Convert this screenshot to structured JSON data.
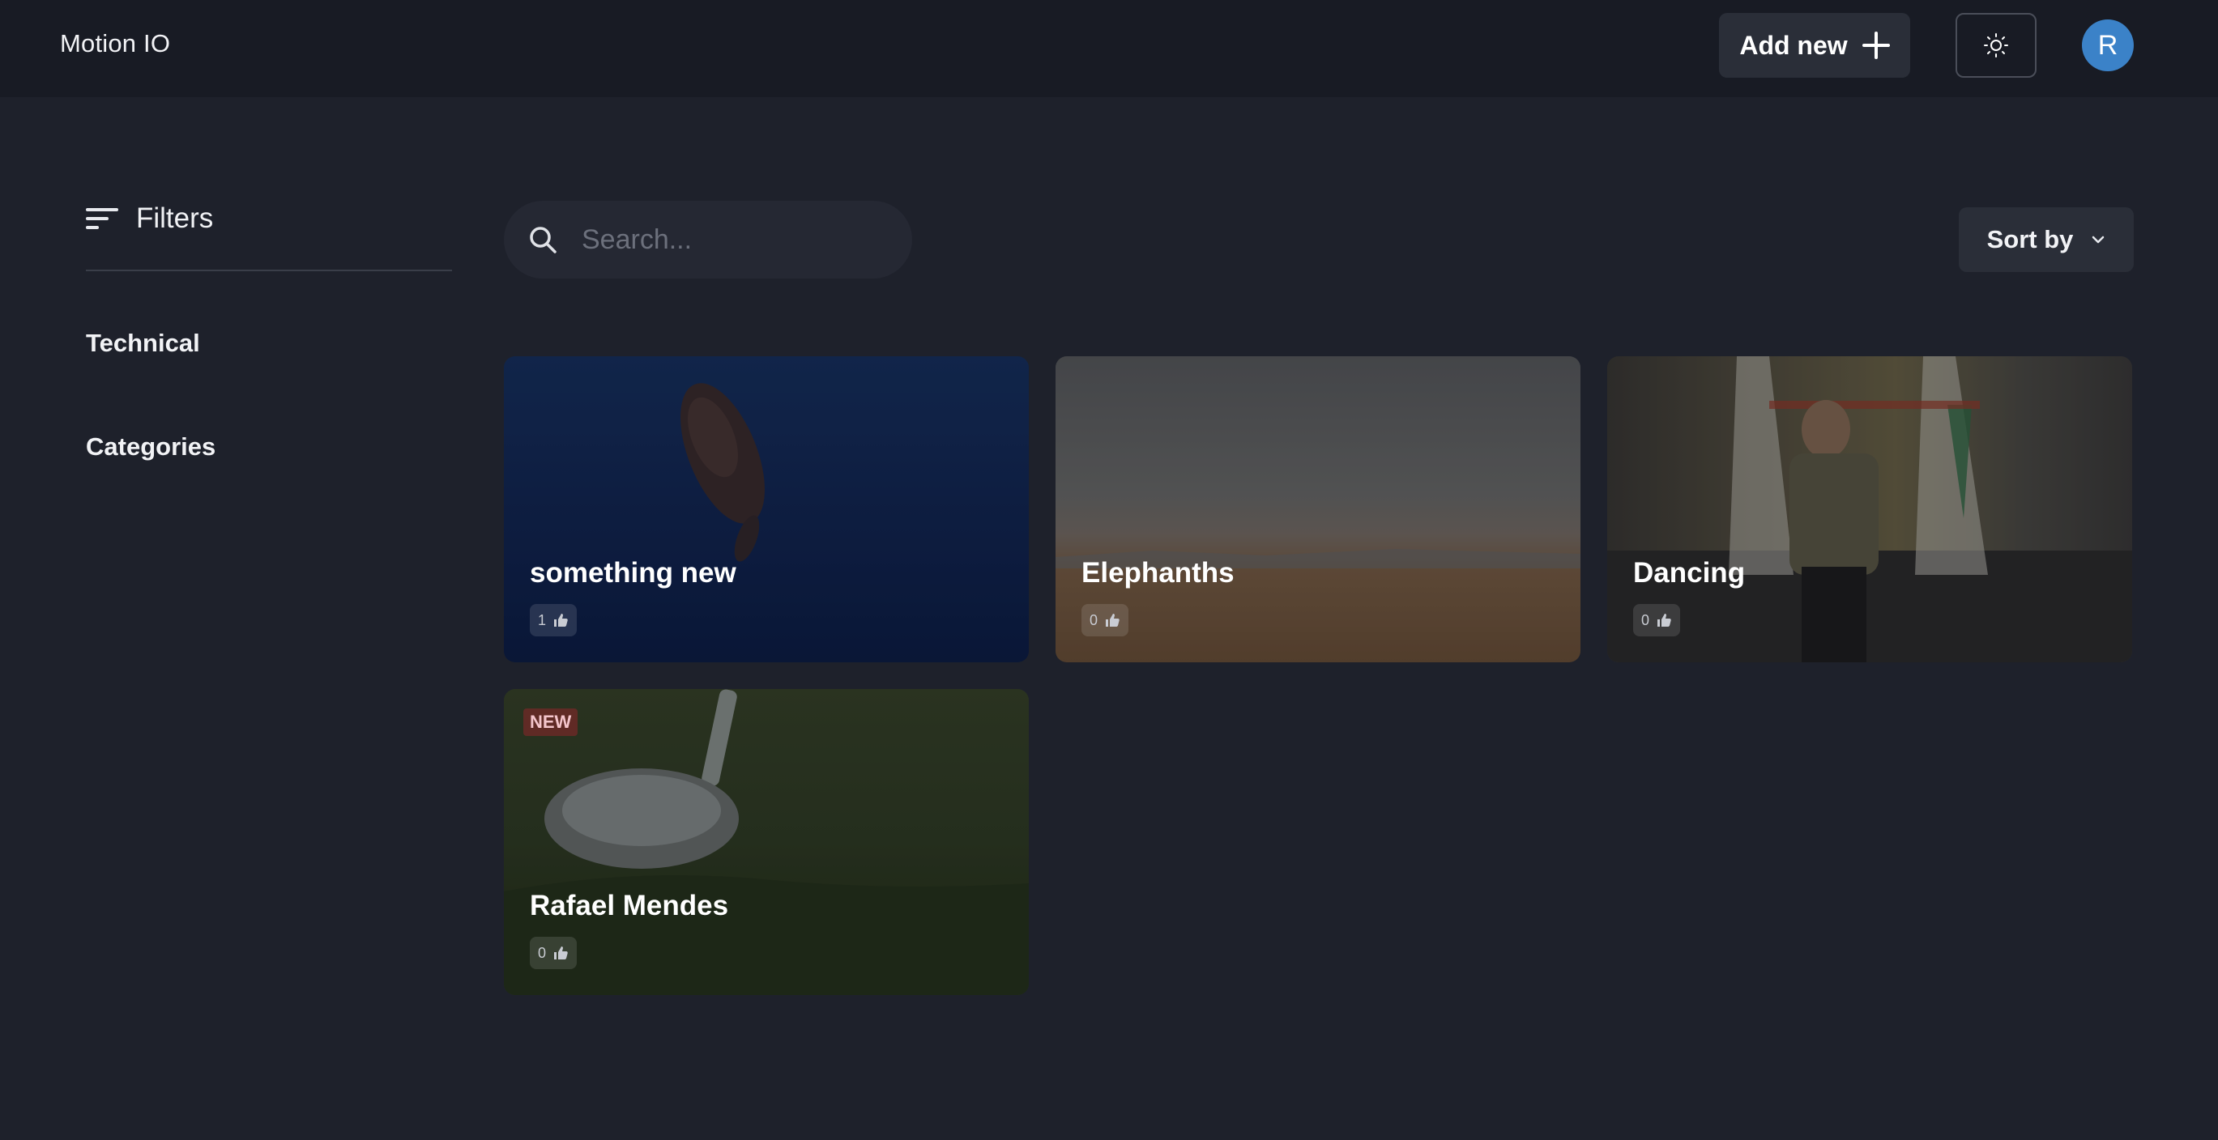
{
  "header": {
    "brand": "Motion IO",
    "add_new_label": "Add new",
    "avatar_initial": "R"
  },
  "sidebar": {
    "filters_label": "Filters",
    "items": [
      {
        "label": "Technical"
      },
      {
        "label": "Categories"
      }
    ]
  },
  "search": {
    "placeholder": "Search...",
    "value": ""
  },
  "sort": {
    "label": "Sort by"
  },
  "cards": [
    {
      "title": "something new",
      "likes": "1",
      "badge": ""
    },
    {
      "title": "Elephanths",
      "likes": "0",
      "badge": ""
    },
    {
      "title": "Dancing",
      "likes": "0",
      "badge": ""
    },
    {
      "title": "Rafael Mendes",
      "likes": "0",
      "badge": "NEW"
    }
  ],
  "colors": {
    "background": "#1e212b",
    "header": "#181b24",
    "button": "#2a2e38",
    "avatar": "#3b82c8"
  }
}
